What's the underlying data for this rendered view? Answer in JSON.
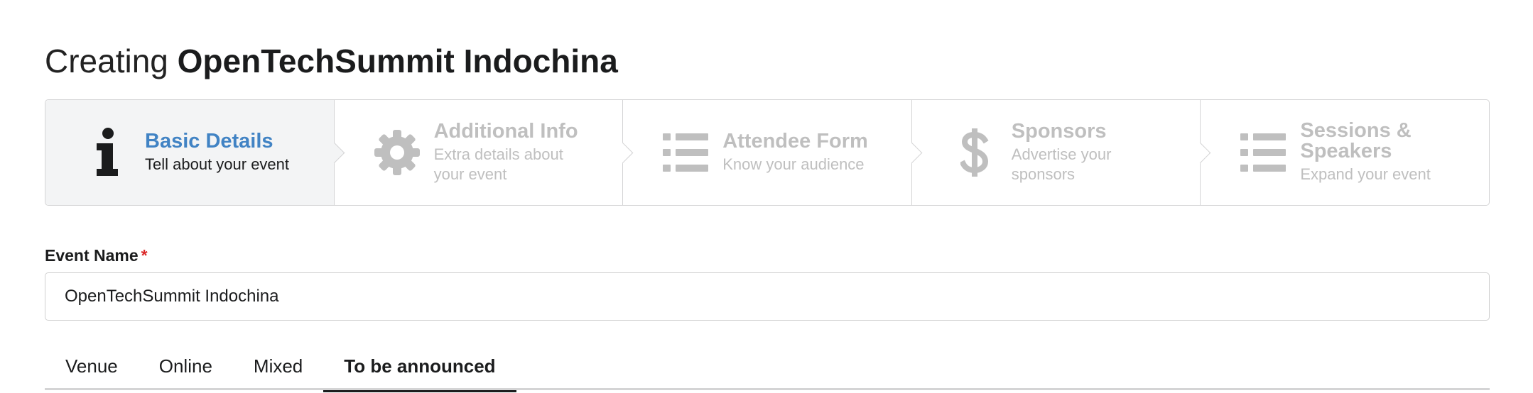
{
  "header": {
    "prefix": "Creating",
    "event_name": "OpenTechSummit Indochina"
  },
  "steps": [
    {
      "title": "Basic Details",
      "description": "Tell about your event",
      "icon": "info-icon",
      "active": true
    },
    {
      "title": "Additional Info",
      "description": "Extra details about your event",
      "icon": "gear-icon",
      "active": false
    },
    {
      "title": "Attendee Form",
      "description": "Know your audience",
      "icon": "list-icon",
      "active": false
    },
    {
      "title": "Sponsors",
      "description": "Advertise your sponsors",
      "icon": "dollar-icon",
      "active": false
    },
    {
      "title": "Sessions & Speakers",
      "description": "Expand your event",
      "icon": "list-icon",
      "active": false
    }
  ],
  "form": {
    "event_name_label": "Event Name",
    "required_marker": "*",
    "event_name_value": "OpenTechSummit Indochina"
  },
  "location_tabs": [
    {
      "label": "Venue",
      "active": false
    },
    {
      "label": "Online",
      "active": false
    },
    {
      "label": "Mixed",
      "active": false
    },
    {
      "label": "To be announced",
      "active": true
    }
  ],
  "colors": {
    "active_step_title": "#4183c4",
    "inactive": "#bfbfbf",
    "required": "#db2828"
  }
}
